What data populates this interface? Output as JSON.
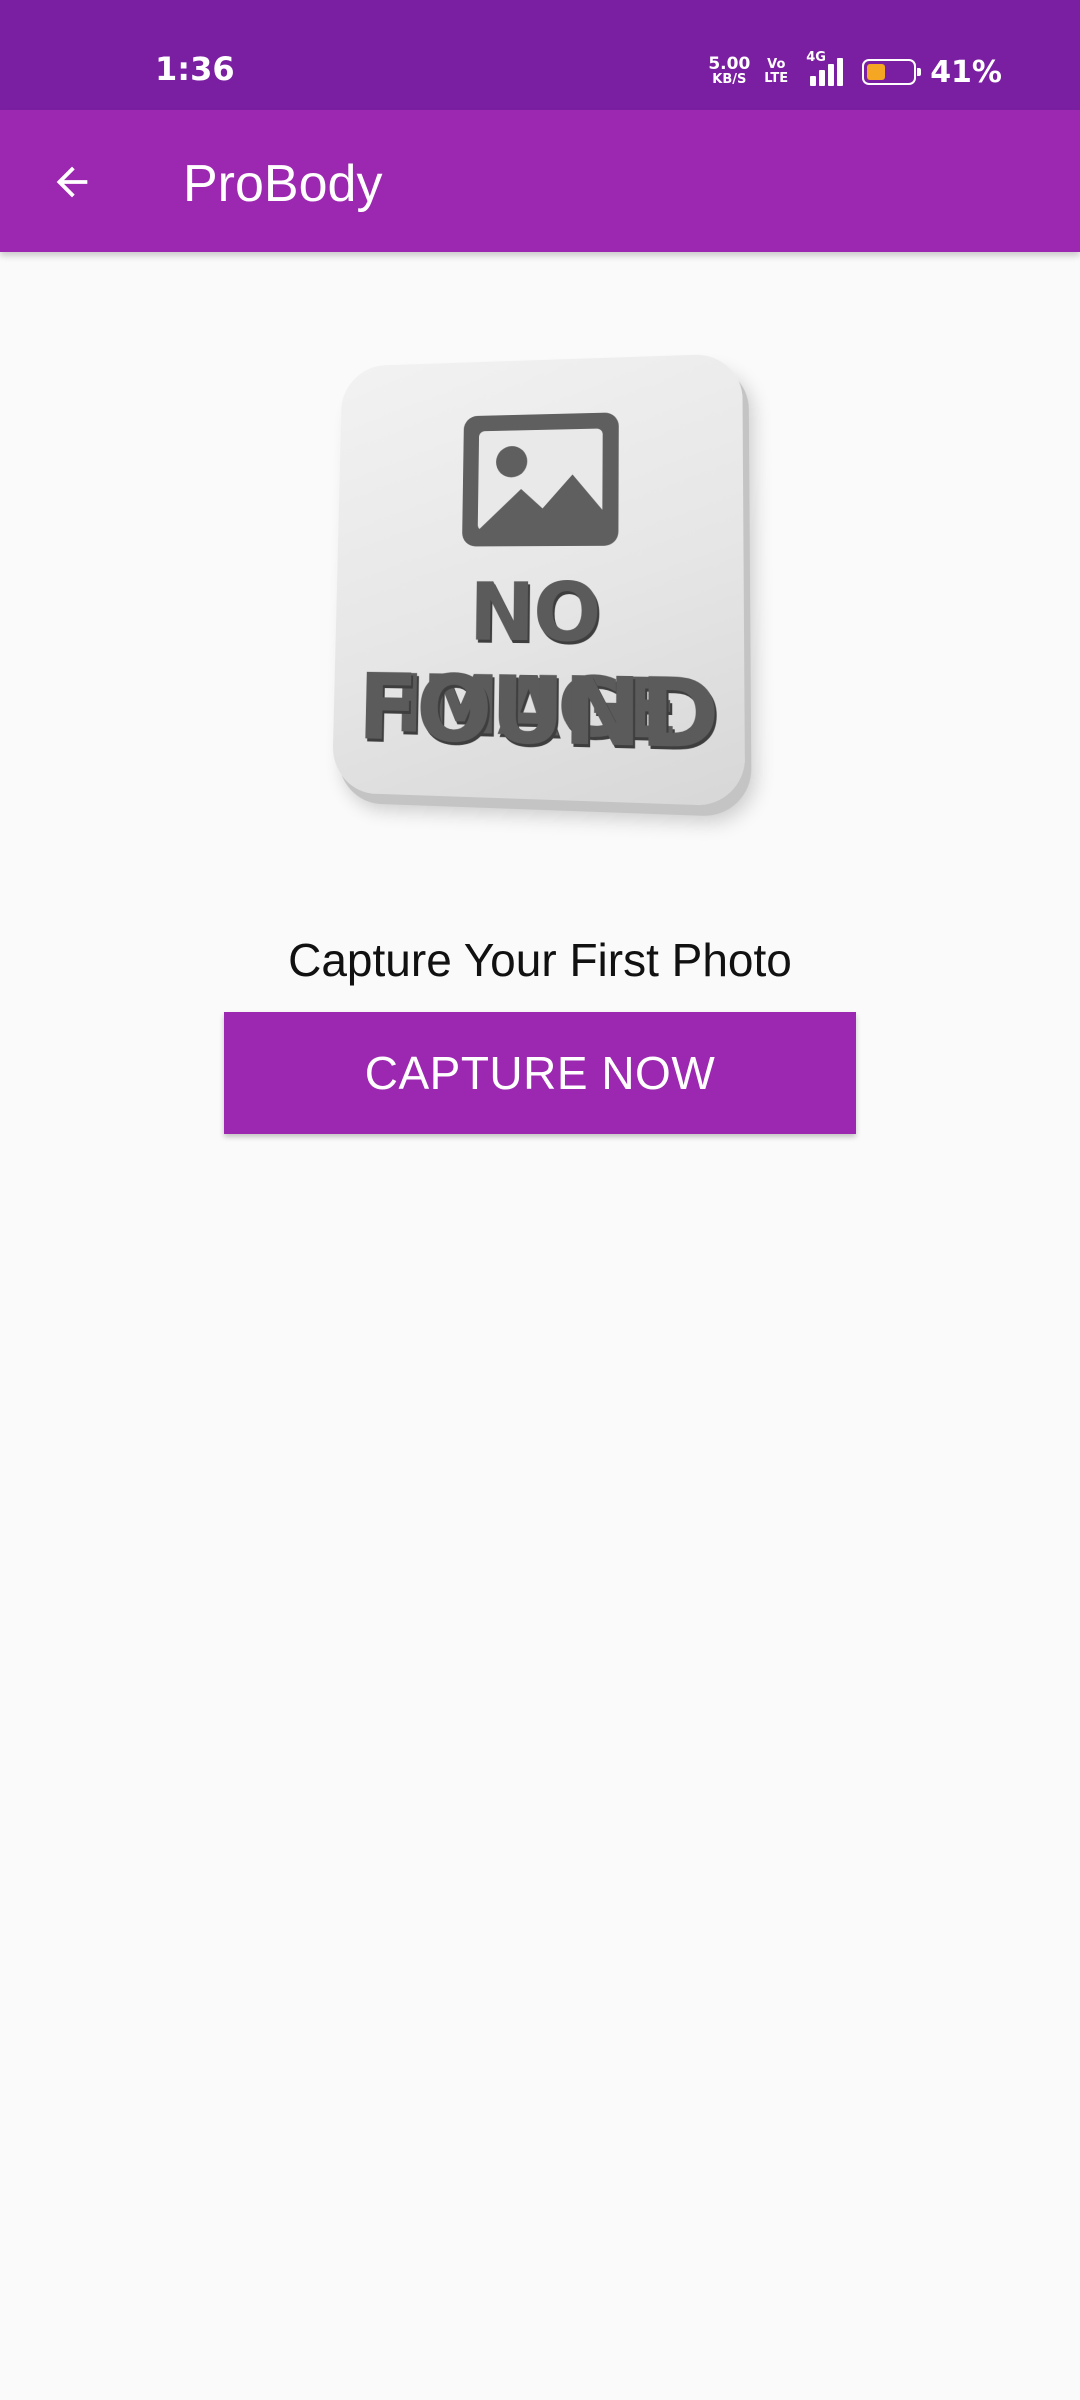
{
  "status_bar": {
    "time": "1:36",
    "net_speed_value": "5.00",
    "net_speed_unit": "KB/S",
    "volte_top": "Vo",
    "volte_bottom": "LTE",
    "network_type": "4G",
    "battery_percent": "41%",
    "battery_level": 0.41,
    "battery_color": "#f5a623"
  },
  "app_bar": {
    "title": "ProBody",
    "back_icon": "arrow-left-icon",
    "color": "#9c27b0"
  },
  "placeholder": {
    "line1": "NO IMAGE",
    "line2": "FOUND",
    "icon": "image-icon"
  },
  "main": {
    "caption": "Capture Your First Photo",
    "capture_button_label": "CAPTURE NOW"
  },
  "colors": {
    "status_bar": "#7b1fa2",
    "primary": "#9c27b0",
    "background": "#fafafa"
  }
}
